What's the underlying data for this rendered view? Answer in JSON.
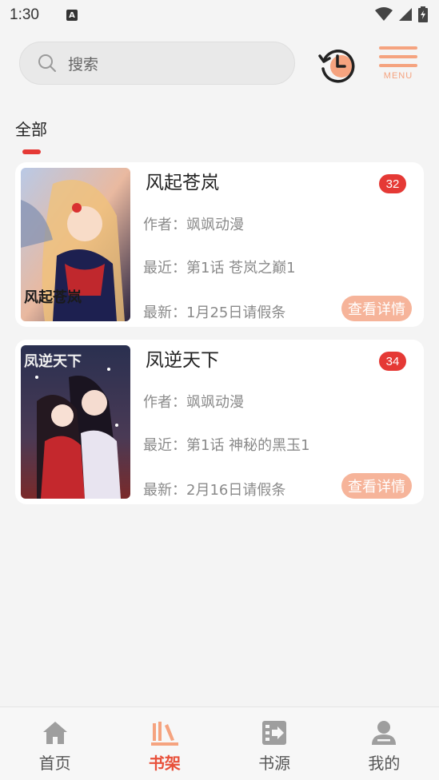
{
  "status_bar": {
    "time": "1:30",
    "notification_letter": "A"
  },
  "header": {
    "search_placeholder": "搜索",
    "menu_label": "MENU"
  },
  "tabs": {
    "active_label": "全部"
  },
  "books": [
    {
      "title": "风起苍岚",
      "badge": "32",
      "author": "作者：飒飒动漫",
      "recent": "最近：第1话 苍岚之巅1",
      "latest": "最新：1月25日请假条",
      "detail_label": "查看详情",
      "cover_text": "风起苍岚"
    },
    {
      "title": "凤逆天下",
      "badge": "34",
      "author": "作者：飒飒动漫",
      "recent": "最近：第1话 神秘的黑玉1",
      "latest": "最新：2月16日请假条",
      "detail_label": "查看详情",
      "cover_text": "凤逆天下"
    }
  ],
  "bottom_nav": [
    {
      "label": "首页",
      "icon": "home-icon",
      "active": false
    },
    {
      "label": "书架",
      "icon": "bookshelf-icon",
      "active": true
    },
    {
      "label": "书源",
      "icon": "book-source-icon",
      "active": false
    },
    {
      "label": "我的",
      "icon": "profile-icon",
      "active": false
    }
  ],
  "colors": {
    "accent_red": "#e53935",
    "accent_orange": "#f5a37f",
    "detail_button": "#f6b49a",
    "background": "#f4f4f4"
  }
}
